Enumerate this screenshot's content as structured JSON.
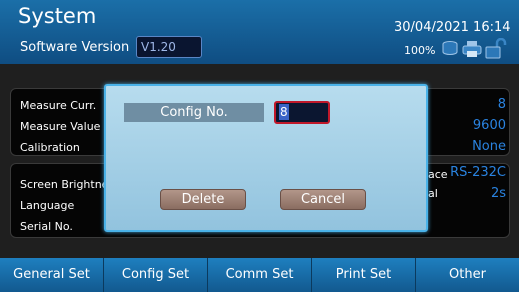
{
  "header": {
    "title": "System",
    "software_version_label": "Software Version",
    "software_version_value": "V1.20",
    "datetime": "30/04/2021 16:14",
    "battery": "100%"
  },
  "measure_panel": {
    "items": [
      {
        "label": "Measure Curr.",
        "value": "8"
      },
      {
        "label": "Measure Value",
        "value": "9600"
      },
      {
        "label": "Calibration",
        "value": "None"
      }
    ]
  },
  "settings_panel": {
    "items": [
      {
        "label": "Screen Brightness",
        "value": "RS-232C",
        "right_label": "ace"
      },
      {
        "label": "Language",
        "value": "2s",
        "right_label": "al"
      },
      {
        "label": "Serial No.",
        "value": ""
      }
    ]
  },
  "dialog": {
    "config_label": "Config No.",
    "config_value": "8",
    "delete_label": "Delete",
    "cancel_label": "Cancel"
  },
  "tabs": [
    {
      "label": "General Set"
    },
    {
      "label": "Config Set"
    },
    {
      "label": "Comm Set"
    },
    {
      "label": "Print Set"
    },
    {
      "label": "Other"
    }
  ],
  "colors": {
    "header_blue": "#1b6fa8",
    "value_blue": "#2a83e0",
    "dialog_bg": "#b7dcee",
    "input_border": "#c0182a",
    "button_brown": "#9c8074"
  },
  "icons": [
    "db-icon",
    "printer-icon",
    "unlock-icon"
  ]
}
